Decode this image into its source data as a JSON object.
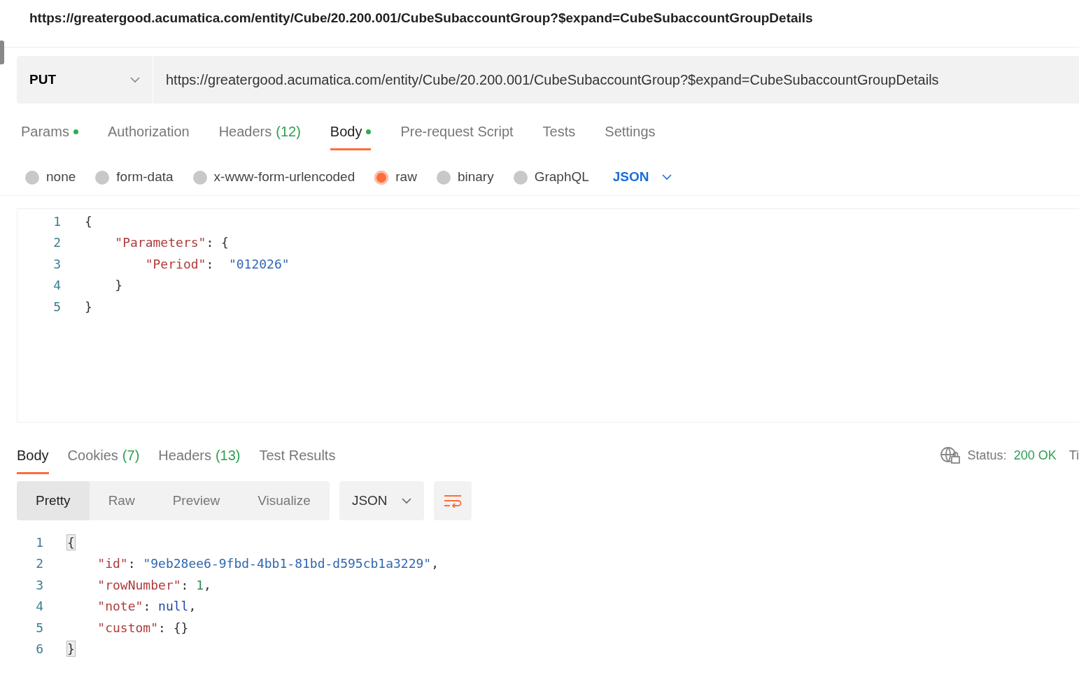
{
  "address_bar": {
    "url": "https://greatergood.acumatica.com/entity/Cube/20.200.001/CubeSubaccountGroup?$expand=CubeSubaccountGroupDetails"
  },
  "request": {
    "method": "PUT",
    "url": "https://greatergood.acumatica.com/entity/Cube/20.200.001/CubeSubaccountGroup?$expand=CubeSubaccountGroupDetails"
  },
  "request_tabs": [
    {
      "label": "Params",
      "dot": true,
      "selected": false
    },
    {
      "label": "Authorization",
      "dot": false,
      "selected": false
    },
    {
      "label": "Headers",
      "count": "(12)",
      "dot": false,
      "selected": false
    },
    {
      "label": "Body",
      "dot": true,
      "selected": true
    },
    {
      "label": "Pre-request Script",
      "dot": false,
      "selected": false
    },
    {
      "label": "Tests",
      "dot": false,
      "selected": false
    },
    {
      "label": "Settings",
      "dot": false,
      "selected": false
    }
  ],
  "body_types": [
    {
      "label": "none",
      "selected": false
    },
    {
      "label": "form-data",
      "selected": false
    },
    {
      "label": "x-www-form-urlencoded",
      "selected": false
    },
    {
      "label": "raw",
      "selected": true
    },
    {
      "label": "binary",
      "selected": false
    },
    {
      "label": "GraphQL",
      "selected": false
    }
  ],
  "raw_format": "JSON",
  "request_body": [
    {
      "number": "1",
      "tokens": [
        {
          "t": "{",
          "kind": "punct"
        }
      ]
    },
    {
      "number": "2",
      "tokens": [
        {
          "t": "    \"Parameters\"",
          "kind": "key"
        },
        {
          "t": ": {",
          "kind": "punct"
        }
      ]
    },
    {
      "number": "3",
      "tokens": [
        {
          "t": "        \"Period\"",
          "kind": "key"
        },
        {
          "t": ":  ",
          "kind": "punct"
        },
        {
          "t": "\"012026\"",
          "kind": "string"
        }
      ]
    },
    {
      "number": "4",
      "tokens": [
        {
          "t": "    }",
          "kind": "punct"
        }
      ]
    },
    {
      "number": "5",
      "tokens": [
        {
          "t": "}",
          "kind": "punct"
        }
      ]
    }
  ],
  "response_tabs": [
    {
      "label": "Body",
      "selected": true
    },
    {
      "label": "Cookies",
      "count": "(7)",
      "selected": false
    },
    {
      "label": "Headers",
      "count": "(13)",
      "selected": false
    },
    {
      "label": "Test Results",
      "selected": false
    }
  ],
  "status": {
    "label": "Status:",
    "value": "200 OK",
    "cut_label": "Ti"
  },
  "view_modes": [
    {
      "label": "Pretty",
      "selected": true
    },
    {
      "label": "Raw",
      "selected": false
    },
    {
      "label": "Preview",
      "selected": false
    },
    {
      "label": "Visualize",
      "selected": false
    }
  ],
  "response_format": "JSON",
  "response_body": [
    {
      "number": "1",
      "tokens": [
        {
          "t": "{",
          "kind": "bracket"
        }
      ]
    },
    {
      "number": "2",
      "tokens": [
        {
          "t": "    \"id\"",
          "kind": "key"
        },
        {
          "t": ": ",
          "kind": "punct"
        },
        {
          "t": "\"9eb28ee6-9fbd-4bb1-81bd-d595cb1a3229\"",
          "kind": "string"
        },
        {
          "t": ",",
          "kind": "punct"
        }
      ]
    },
    {
      "number": "3",
      "tokens": [
        {
          "t": "    \"rowNumber\"",
          "kind": "key"
        },
        {
          "t": ": ",
          "kind": "punct"
        },
        {
          "t": "1",
          "kind": "number"
        },
        {
          "t": ",",
          "kind": "punct"
        }
      ]
    },
    {
      "number": "4",
      "tokens": [
        {
          "t": "    \"note\"",
          "kind": "key"
        },
        {
          "t": ": ",
          "kind": "punct"
        },
        {
          "t": "null",
          "kind": "keyword"
        },
        {
          "t": ",",
          "kind": "punct"
        }
      ]
    },
    {
      "number": "5",
      "tokens": [
        {
          "t": "    \"custom\"",
          "kind": "key"
        },
        {
          "t": ": {}",
          "kind": "punct"
        }
      ]
    },
    {
      "number": "6",
      "tokens": [
        {
          "t": "}",
          "kind": "bracket"
        }
      ]
    }
  ]
}
